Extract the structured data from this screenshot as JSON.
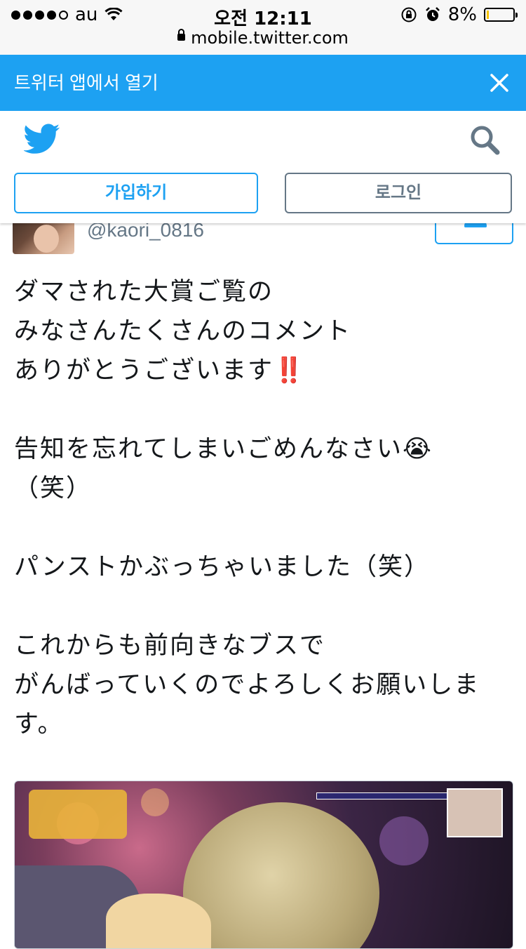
{
  "status_bar": {
    "carrier": "au",
    "time": "오전 12:11",
    "battery_percent": "8%",
    "battery_level": 0.08,
    "url": "mobile.twitter.com"
  },
  "banner": {
    "text": "트위터 앱에서 열기",
    "close_icon": "close-icon"
  },
  "header": {
    "logo_icon": "twitter-bird-icon",
    "search_icon": "search-icon",
    "signup_label": "가입하기",
    "login_label": "로그인"
  },
  "tweet": {
    "handle": "@kaori_0816",
    "follow_icon": "follow-person-icon",
    "text": "ダマされた大賞ご覧の\nみなさんたくさんのコメント\nありがとうございます‼️\n\n告知を忘れてしまいごめんなさい😭\n（笑）\n\nパンストかぶっちゃいました（笑）\n\nこれからも前向きなブスで\nがんばっていくのでよろしくお願いしま\nす。"
  },
  "colors": {
    "twitter_blue": "#1da1f2",
    "gray": "#657786",
    "text": "#14171a"
  }
}
